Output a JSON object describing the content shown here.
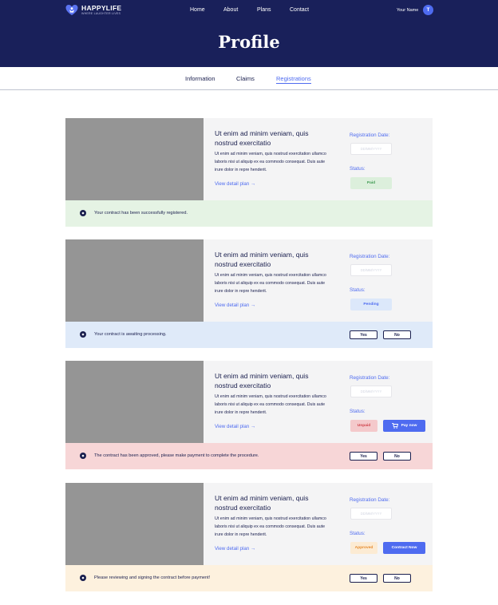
{
  "header": {
    "logo_name": "HAPPYLIFE",
    "logo_tagline": "WHERE LAUGHTER LIVES",
    "nav": [
      "Home",
      "About",
      "Plans",
      "Contact"
    ],
    "user_name": "Your Name",
    "avatar_initial": "T",
    "page_title": "Profile"
  },
  "tabs": [
    {
      "label": "Information",
      "active": false
    },
    {
      "label": "Claims",
      "active": false
    },
    {
      "label": "Registrations",
      "active": true
    }
  ],
  "colors": {
    "navy": "#19205a",
    "accent": "#4e6bf0",
    "paid_bg": "#dcefdc",
    "pending_bg": "#dce8fa",
    "unpaid_bg": "#f4c9cb",
    "approved_bg": "#fcebd3"
  },
  "cards": [
    {
      "title": "Ut enim ad minim veniam, quis nostrud exercitatio",
      "description": "Ut enim ad minim veniam, quis nostrud exercitation ullamco laboris nisi ut aliquip ex ea commodo consequat. Duis aute irure dolor in repre henderit.",
      "link": "View detail plan →",
      "reg_label": "Registration Date:",
      "date_placeholder": "DD/MM/YYYY",
      "status_label": "Status:",
      "status": "Paid",
      "notice": "Your contract has been successfully registered."
    },
    {
      "title": "Ut enim ad minim veniam, quis nostrud exercitatio",
      "description": "Ut enim ad minim veniam, quis nostrud exercitation ullamco laboris nisi ut aliquip ex ea commodo consequat. Duis aute irure dolor in repre henderit.",
      "link": "View detail plan →",
      "reg_label": "Registration Date:",
      "date_placeholder": "DD/MM/YYYY",
      "status_label": "Status:",
      "status": "Pending",
      "notice": "Your contract is awaiting processing.",
      "yes": "Yes",
      "no": "No"
    },
    {
      "title": "Ut enim ad minim veniam, quis nostrud exercitatio",
      "description": "Ut enim ad minim veniam, quis nostrud exercitation ullamco laboris nisi ut aliquip ex ea commodo consequat. Duis aute irure dolor in repre henderit.",
      "link": "View detail plan →",
      "reg_label": "Registration Date:",
      "date_placeholder": "DD/MM/YYYY",
      "status_label": "Status:",
      "status": "Unpaid",
      "action": "Pay now",
      "notice": "The contract has been approved, please make payment to complete the procedure.",
      "yes": "Yes",
      "no": "No"
    },
    {
      "title": "Ut enim ad minim veniam, quis nostrud exercitatio",
      "description": "Ut enim ad minim veniam, quis nostrud exercitation ullamco laboris nisi ut aliquip ex ea commodo consequat. Duis aute irure dolor in repre henderit.",
      "link": "View detail plan →",
      "reg_label": "Registration Date:",
      "date_placeholder": "DD/MM/YYYY",
      "status_label": "Status:",
      "status": "Approved",
      "action": "Contract Now",
      "notice": "Please reviewing and signing the contract before payment!",
      "yes": "Yes",
      "no": "No"
    }
  ]
}
